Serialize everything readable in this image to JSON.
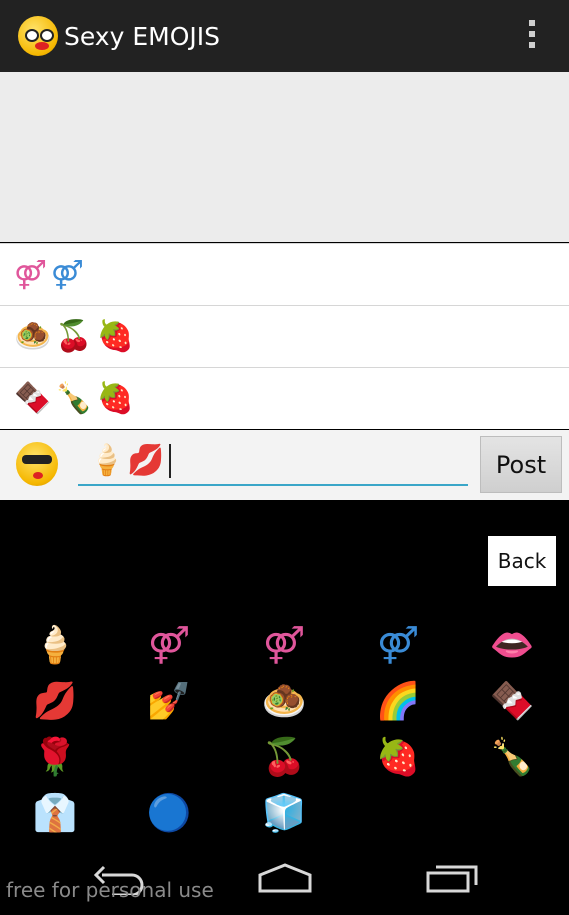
{
  "app": {
    "title": "Sexy EMOJIS"
  },
  "conversation": {
    "rows": [
      {
        "emojis": [
          "⚤",
          "⚤"
        ]
      },
      {
        "emojis": [
          "🧆",
          "🍒",
          "🍓"
        ]
      },
      {
        "emojis": [
          "🍫",
          "🍾",
          "🍓"
        ]
      }
    ]
  },
  "composer": {
    "input_emojis": [
      "🍦",
      "💋"
    ],
    "post_label": "Post"
  },
  "keyboard": {
    "back_label": "Back",
    "emojis": [
      "🍦",
      "⚤",
      "⚤",
      "⚤",
      "👄",
      "💋",
      "💅",
      "🧆",
      "🌈",
      "🍫",
      "🌹",
      "🛏",
      "🍒",
      "🍓",
      "🍾",
      "👔",
      "🔵",
      "🧊"
    ]
  },
  "watermark": "free for personal use"
}
